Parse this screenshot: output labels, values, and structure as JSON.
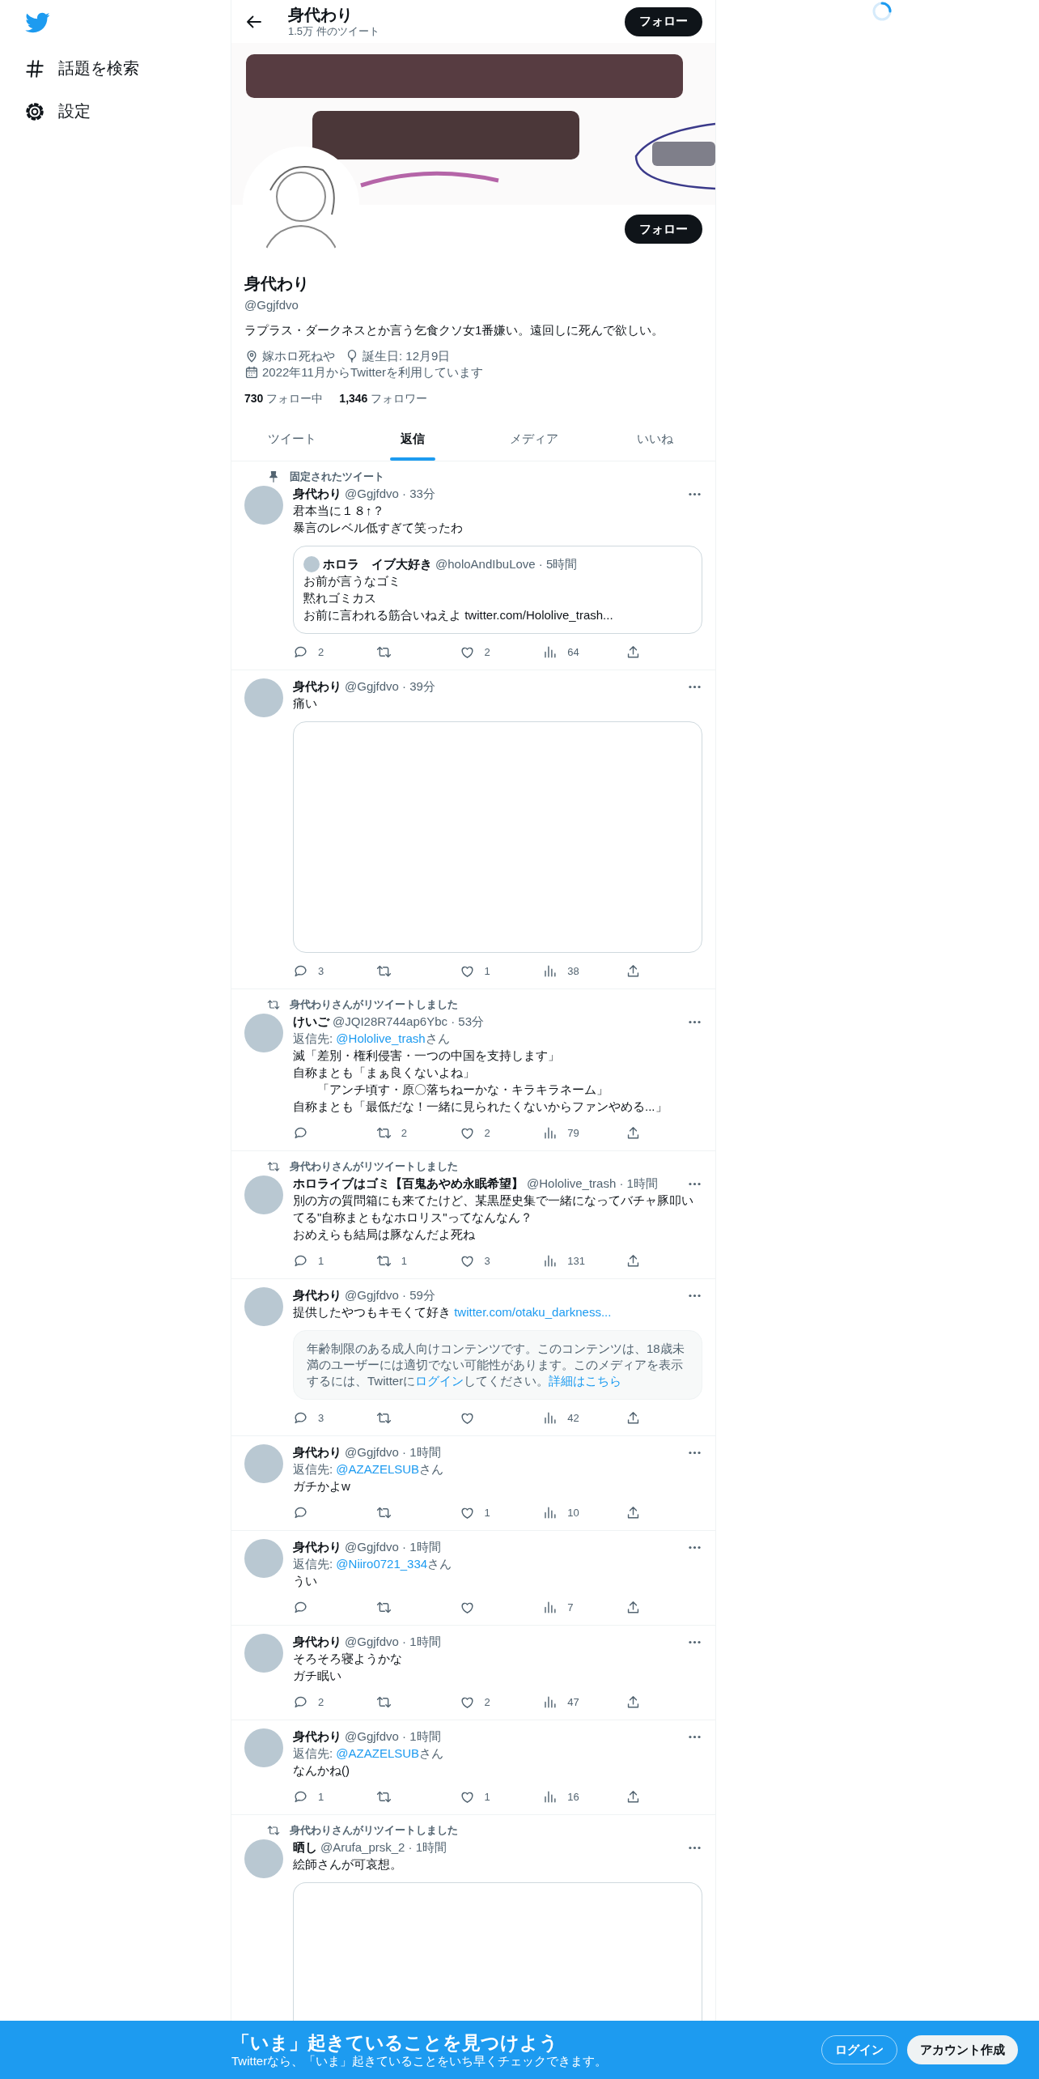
{
  "sidebar": {
    "items": [
      {
        "kind": "hashtag",
        "label": "話題を検索"
      },
      {
        "kind": "gear",
        "label": "設定"
      }
    ]
  },
  "header": {
    "title": "身代わり",
    "subtitle": "1.5万 件のツイート",
    "follow_button": "フォロー"
  },
  "profile": {
    "follow_button": "フォロー",
    "name": "身代わり",
    "handle": "@Ggjfdvo",
    "bio": "ラプラス・ダークネスとか言う乞食クソ女1番嫌い。遠回しに死んで欲しい。",
    "location": "嫁ホロ死ねや",
    "birthday": "誕生日: 12月9日",
    "joined": "2022年11月からTwitterを利用しています",
    "following_count": "730",
    "following_label": "フォロー中",
    "followers_count": "1,346",
    "followers_label": "フォロワー"
  },
  "tabs": [
    {
      "label": "ツイート",
      "selected": false
    },
    {
      "label": "返信",
      "selected": true
    },
    {
      "label": "メディア",
      "selected": false
    },
    {
      "label": "いいね",
      "selected": false
    }
  ],
  "tweets": [
    {
      "social_context": {
        "kind": "pinned",
        "text": "固定されたツイート"
      },
      "name": "身代わり",
      "meta": "@Ggjfdvo · 33分",
      "lines": [
        "君本当に１８↑？",
        "暴言のレベル低すぎて笑ったわ"
      ],
      "quote": {
        "name": "ホロラ　イブ大好き",
        "meta": "@holoAndIbuLove · 5時間",
        "lines": [
          "お前が言うなゴミ",
          "黙れゴミカス",
          "お前に言われる筋合いねえよ twitter.com/Hololive_trash..."
        ]
      },
      "actions": [
        {
          "kind": "reply",
          "count": "2"
        },
        {
          "kind": "retweet"
        },
        {
          "kind": "like",
          "count": "2"
        },
        {
          "kind": "views",
          "count": "64"
        },
        {
          "kind": "share"
        }
      ]
    },
    {
      "name": "身代わり",
      "meta": "@Ggjfdvo · 39分",
      "lines": [
        "痛い"
      ],
      "media": {
        "kind": "empty"
      },
      "actions": [
        {
          "kind": "reply",
          "count": "3"
        },
        {
          "kind": "retweet"
        },
        {
          "kind": "like",
          "count": "1"
        },
        {
          "kind": "views",
          "count": "38"
        },
        {
          "kind": "share"
        }
      ]
    },
    {
      "social_context": {
        "kind": "retweet",
        "text": "身代わりさんがリツイートしました"
      },
      "name": "けいご",
      "meta": "@JQI28R744ap6Ybc · 53分",
      "reply_to": {
        "label": "返信先: ",
        "handle": "@Hololive_trash",
        "suffix": "さん"
      },
      "lines": [
        "滅「差別・権利侵害・一つの中国を支持します」",
        "自称まとも「まぁ良くないよね」",
        "　　「アンチ頃す・原〇落ちねーかな・キラキラネーム」",
        "自称まとも「最低だな！一緒に見られたくないからファンやめる...」"
      ],
      "actions": [
        {
          "kind": "reply"
        },
        {
          "kind": "retweet",
          "count": "2"
        },
        {
          "kind": "like",
          "count": "2"
        },
        {
          "kind": "views",
          "count": "79"
        },
        {
          "kind": "share"
        }
      ]
    },
    {
      "social_context": {
        "kind": "retweet",
        "text": "身代わりさんがリツイートしました"
      },
      "name": "ホロライブはゴミ【百鬼あやめ永眠希望】",
      "meta": "@Hololive_trash · 1時間",
      "lines": [
        "別の方の質問箱にも来てたけど、某黒歴史集で一緒になってバチャ豚叩いてる\"自称まともなホロリス\"ってなんなん？",
        "おめえらも結局は豚なんだよ死ね"
      ],
      "actions": [
        {
          "kind": "reply",
          "count": "1"
        },
        {
          "kind": "retweet",
          "count": "1"
        },
        {
          "kind": "like",
          "count": "3"
        },
        {
          "kind": "views",
          "count": "131"
        },
        {
          "kind": "share"
        }
      ]
    },
    {
      "name": "身代わり",
      "meta": "@Ggjfdvo · 59分",
      "lines": [
        "提供したやつもキモくて好き "
      ],
      "link": "twitter.com/otaku_darkness...",
      "notice": [
        {
          "kind": "text",
          "text": "年齢制限のある成人向けコンテンツです。このコンテンツは、18歳未満のユーザーには適切でない可能性があります。このメディアを表示するには、Twitterに"
        },
        {
          "kind": "link",
          "text": "ログイン"
        },
        {
          "kind": "text",
          "text": "してください。"
        },
        {
          "kind": "link",
          "text": "詳細はこちら"
        }
      ],
      "actions": [
        {
          "kind": "reply",
          "count": "3"
        },
        {
          "kind": "retweet"
        },
        {
          "kind": "like"
        },
        {
          "kind": "views",
          "count": "42"
        },
        {
          "kind": "share"
        }
      ]
    },
    {
      "name": "身代わり",
      "meta": "@Ggjfdvo · 1時間",
      "reply_to": {
        "label": "返信先: ",
        "handle": "@AZAZELSUB",
        "suffix": "さん"
      },
      "lines": [
        "ガチかよw"
      ],
      "actions": [
        {
          "kind": "reply"
        },
        {
          "kind": "retweet"
        },
        {
          "kind": "like",
          "count": "1"
        },
        {
          "kind": "views",
          "count": "10"
        },
        {
          "kind": "share"
        }
      ]
    },
    {
      "name": "身代わり",
      "meta": "@Ggjfdvo · 1時間",
      "reply_to": {
        "label": "返信先: ",
        "handle": "@Niiro0721_334",
        "suffix": "さん"
      },
      "lines": [
        "うい"
      ],
      "actions": [
        {
          "kind": "reply"
        },
        {
          "kind": "retweet"
        },
        {
          "kind": "like"
        },
        {
          "kind": "views",
          "count": "7"
        },
        {
          "kind": "share"
        }
      ]
    },
    {
      "name": "身代わり",
      "meta": "@Ggjfdvo · 1時間",
      "lines": [
        "そろそろ寝ようかな",
        "ガチ眠い"
      ],
      "actions": [
        {
          "kind": "reply",
          "count": "2"
        },
        {
          "kind": "retweet"
        },
        {
          "kind": "like",
          "count": "2"
        },
        {
          "kind": "views",
          "count": "47"
        },
        {
          "kind": "share"
        }
      ]
    },
    {
      "name": "身代わり",
      "meta": "@Ggjfdvo · 1時間",
      "reply_to": {
        "label": "返信先: ",
        "handle": "@AZAZELSUB",
        "suffix": "さん"
      },
      "lines": [
        "なんかね()"
      ],
      "actions": [
        {
          "kind": "reply",
          "count": "1"
        },
        {
          "kind": "retweet"
        },
        {
          "kind": "like",
          "count": "1"
        },
        {
          "kind": "views",
          "count": "16"
        },
        {
          "kind": "share"
        }
      ]
    },
    {
      "social_context": {
        "kind": "retweet",
        "text": "身代わりさんがリツイートしました"
      },
      "name": "晒し",
      "meta": "@Arufa_prsk_2 · 1時間",
      "lines": [
        "絵師さんが可哀想。"
      ],
      "media": {
        "kind": "empty",
        "cut_off": true
      }
    }
  ],
  "bottom_bar": {
    "title": "「いま」起きていることを見つけよう",
    "subtitle": "Twitterなら、「いま」起きていることをいち早くチェックできます。",
    "login_button": "ログイン",
    "signup_button": "アカウント作成"
  }
}
